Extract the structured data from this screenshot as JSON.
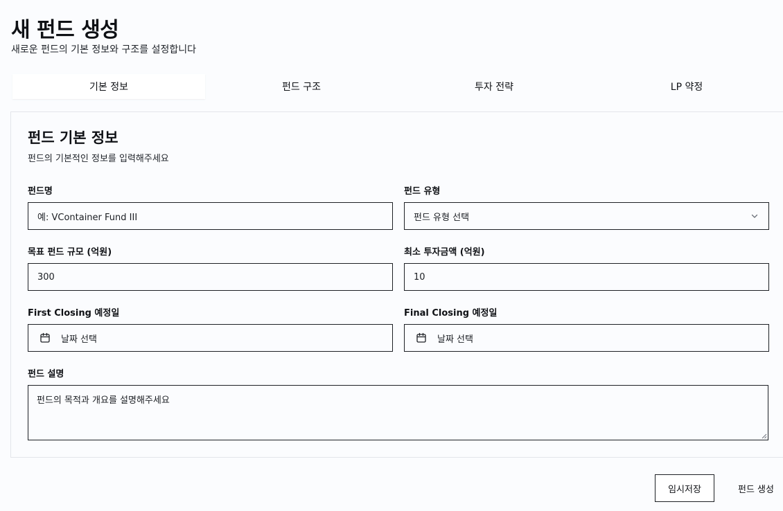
{
  "header": {
    "title": "새 펀드 생성",
    "subtitle": "새로운 펀드의 기본 정보와 구조를 설정합니다"
  },
  "tabs": [
    {
      "label": "기본 정보",
      "active": true
    },
    {
      "label": "펀드 구조",
      "active": false
    },
    {
      "label": "투자 전략",
      "active": false
    },
    {
      "label": "LP 약정",
      "active": false
    }
  ],
  "card": {
    "title": "펀드 기본 정보",
    "description": "펀드의 기본적인 정보를 입력해주세요"
  },
  "form": {
    "fund_name": {
      "label": "펀드명",
      "placeholder": "예: VContainer Fund III"
    },
    "fund_type": {
      "label": "펀드 유형",
      "value": "펀드 유형 선택",
      "icon": "chevron-down-icon"
    },
    "target_size": {
      "label": "목표 펀드 규모 (억원)",
      "value": "300"
    },
    "min_investment": {
      "label": "최소 투자금액 (억원)",
      "value": "10"
    },
    "first_closing": {
      "label": "First Closing 예정일",
      "value": "날짜 선택",
      "icon": "calendar-icon"
    },
    "final_closing": {
      "label": "Final Closing 예정일",
      "value": "날짜 선택",
      "icon": "calendar-icon"
    },
    "description": {
      "label": "펀드 설명",
      "placeholder": "펀드의 목적과 개요를 설명해주세요"
    }
  },
  "actions": {
    "draft_label": "임시저장",
    "create_label": "펀드 생성"
  },
  "colors": {
    "background": "#fbfcfe",
    "border": "#1c1f24",
    "card_border": "#e3e5ea",
    "text": "#0f1115"
  }
}
